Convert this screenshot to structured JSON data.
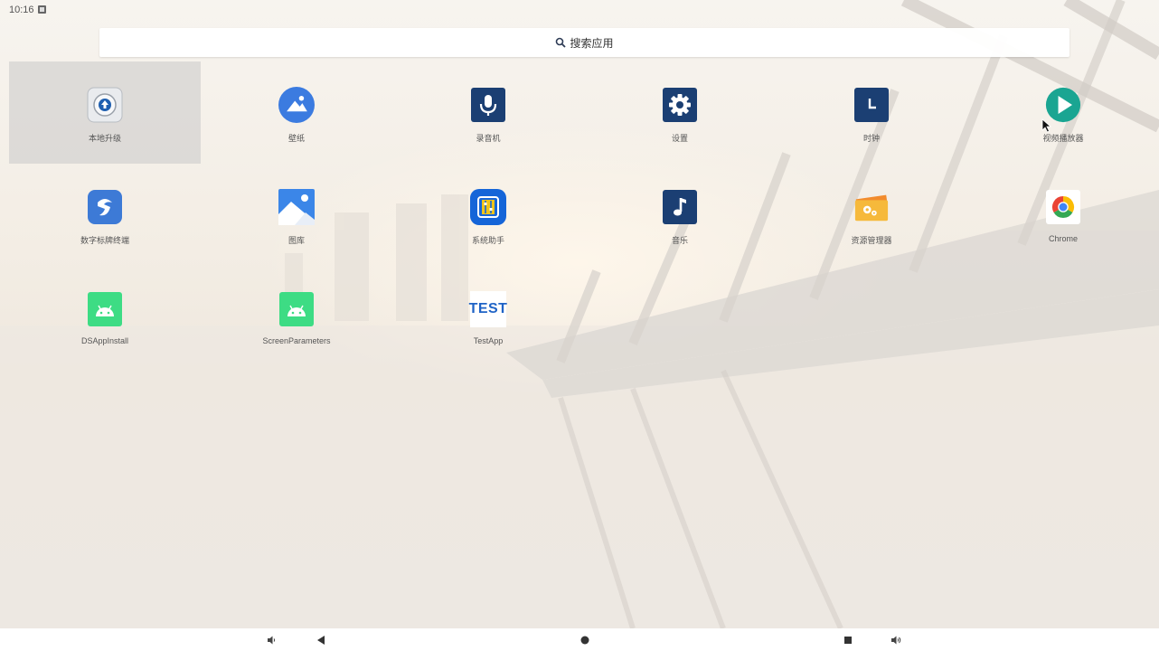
{
  "status_bar": {
    "time": "10:16",
    "notification_icon": "notification-icon"
  },
  "search": {
    "label": "搜索应用",
    "icon": "search-icon"
  },
  "apps": [
    {
      "label": "本地升级",
      "icon": "upgrade-icon",
      "selected": true
    },
    {
      "label": "壁纸",
      "icon": "wallpaper-icon",
      "selected": false
    },
    {
      "label": "录音机",
      "icon": "microphone-icon",
      "selected": false
    },
    {
      "label": "设置",
      "icon": "gear-icon",
      "selected": false
    },
    {
      "label": "时钟",
      "icon": "clock-icon",
      "selected": false
    },
    {
      "label": "视频播放器",
      "icon": "play-icon",
      "selected": false
    },
    {
      "label": "数字标牌终端",
      "icon": "signage-icon",
      "selected": false
    },
    {
      "label": "图库",
      "icon": "gallery-icon",
      "selected": false
    },
    {
      "label": "系统助手",
      "icon": "system-helper-icon",
      "selected": false
    },
    {
      "label": "音乐",
      "icon": "music-note-icon",
      "selected": false
    },
    {
      "label": "资源管理器",
      "icon": "folder-gear-icon",
      "selected": false
    },
    {
      "label": "Chrome",
      "icon": "chrome-icon",
      "selected": false
    },
    {
      "label": "DSAppInstall",
      "icon": "android-icon",
      "selected": false
    },
    {
      "label": "ScreenParameters",
      "icon": "android-icon",
      "selected": false
    },
    {
      "label": "TestApp",
      "icon": "test-icon",
      "icon_text": "TEST",
      "selected": false
    }
  ],
  "nav_bar": {
    "buttons": [
      "volume-down-icon",
      "back-icon",
      "home-icon",
      "recents-icon",
      "volume-up-icon"
    ]
  },
  "colors": {
    "accent_blue": "#1a4a8a",
    "android_green": "#3ddc84",
    "play_teal": "#1aa592"
  }
}
